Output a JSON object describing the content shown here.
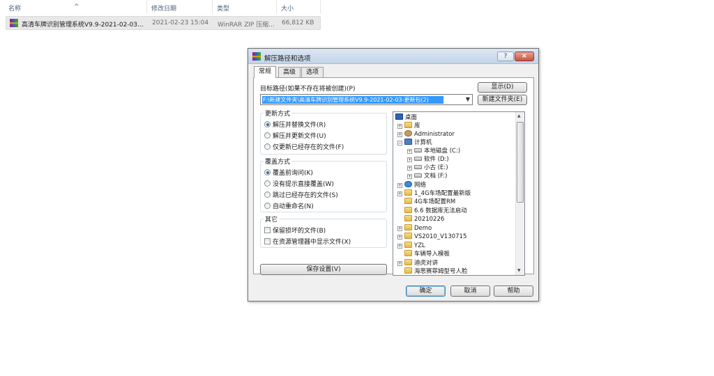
{
  "explorer": {
    "columns": [
      "名称",
      "修改日期",
      "类型",
      "大小"
    ],
    "file": {
      "name": "高清车牌识别管理系统V9.9-2021-02-03...",
      "modified": "2021-02-23 15:04",
      "type": "WinRAR ZIP 压缩...",
      "size": "66,812 KB"
    }
  },
  "dialog": {
    "title": "解压路径和选项",
    "help_label": "?",
    "close_label": "×",
    "tabs": [
      "常规",
      "高级",
      "选项"
    ],
    "target_label": "目标路径(如果不存在将被创建)(P)",
    "target_value": "F:\\新建文件夹\\高清车牌识别管理系统V9.9-2021-02-03-更新包(2)",
    "show_button": "显示(D)",
    "new_folder_button": "新建文件夹(E)",
    "update_group": {
      "title": "更新方式",
      "options": [
        "解压并替换文件(R)",
        "解压并更新文件(U)",
        "仅更新已经存在的文件(F)"
      ]
    },
    "overwrite_group": {
      "title": "覆盖方式",
      "options": [
        "覆盖前询问(K)",
        "没有提示直接覆盖(W)",
        "跳过已经存在的文件(S)",
        "自动重命名(N)"
      ]
    },
    "misc_group": {
      "title": "其它",
      "options": [
        "保留损坏的文件(B)",
        "在资源管理器中显示文件(X)"
      ]
    },
    "save_button": "保存设置(V)",
    "tree": [
      {
        "label": "桌面",
        "icon": "desktop-icon"
      },
      {
        "label": "库",
        "icon": "library-icon"
      },
      {
        "label": "Administrator",
        "icon": "user-icon"
      },
      {
        "label": "计算机",
        "icon": "computer-icon"
      },
      {
        "label": "本地磁盘 (C:)",
        "icon": "drive-icon"
      },
      {
        "label": "软件 (D:)",
        "icon": "drive-icon"
      },
      {
        "label": "小古 (E:)",
        "icon": "drive-icon"
      },
      {
        "label": "文档 (F:)",
        "icon": "drive-icon"
      },
      {
        "label": "网络",
        "icon": "network-icon"
      },
      {
        "label": "1_4G车场配置最新版",
        "icon": "folder-icon"
      },
      {
        "label": "4G车场配置RM",
        "icon": "folder-icon"
      },
      {
        "label": "6.6 数据库无法启动",
        "icon": "folder-icon"
      },
      {
        "label": "20210226",
        "icon": "folder-icon"
      },
      {
        "label": "Demo",
        "icon": "folder-icon"
      },
      {
        "label": "VS2010_V130715",
        "icon": "folder-icon"
      },
      {
        "label": "YZL",
        "icon": "folder-icon"
      },
      {
        "label": "车辆导入模板",
        "icon": "folder-icon"
      },
      {
        "label": "迪虎对讲",
        "icon": "folder-icon"
      },
      {
        "label": "海思赛菲姆型号人脸",
        "icon": "folder-icon"
      }
    ],
    "ok_button": "确定",
    "cancel_button": "取消",
    "help_button": "帮助"
  }
}
